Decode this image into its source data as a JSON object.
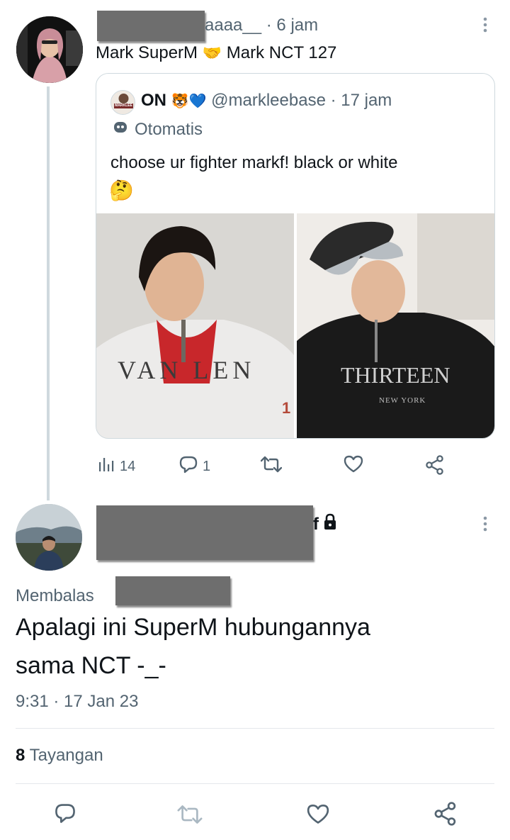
{
  "tweet1": {
    "handle_suffix": "aaaa__",
    "time": "· 6 jam",
    "text_part1": "Mark SuperM",
    "text_emoji": "🤝",
    "text_part2": "Mark NCT 127",
    "quote": {
      "display_name": "ON",
      "name_emojis": "🐯💙",
      "username": "@markleebase",
      "time": "· 17 jam",
      "automated_label": "Otomatis",
      "avatar_text": "MARKLEE",
      "text": "choose ur fighter markf! black or white",
      "text_emoji": "🤔",
      "image1_text": "VAN  LEN",
      "image1_number": "1",
      "image2_text": "THIRTEEN",
      "image2_subtext": "NEW YORK"
    },
    "actions": {
      "views": "14",
      "replies": "1"
    }
  },
  "tweet2": {
    "name_suffix": "f",
    "replying_label": "Membalas",
    "text_line1": "Apalagi ini SuperM hubungannya",
    "text_line2": "sama NCT -_-",
    "timestamp": "9:31 · 17 Jan 23",
    "views_count": "8",
    "views_label": "Tayangan"
  },
  "colors": {
    "text_primary": "#0f1419",
    "text_secondary": "#536471",
    "border": "#cfd9de",
    "redaction": "#6e6e6e"
  }
}
